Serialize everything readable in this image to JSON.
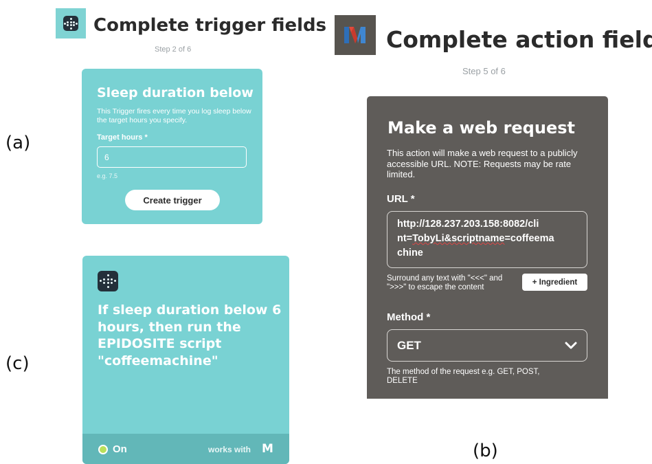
{
  "labels": {
    "a": "(a)",
    "b": "(b)",
    "c": "(c)"
  },
  "trigger": {
    "icon": "fitbit-icon",
    "heading": "Complete trigger fields",
    "step": "Step 2 of 6",
    "card_title": "Sleep duration below",
    "description": "This Trigger fires every time you log sleep below the target hours you specify.",
    "field_label": "Target hours *",
    "field_value": "6",
    "field_hint": "e.g. 7.5",
    "button_label": "Create trigger",
    "accent_color": "#79d2d3"
  },
  "applet": {
    "icon": "fitbit-icon",
    "text": "If sleep duration below 6 hours, then run the EPIDOSITE script \"coffeemachine\"",
    "status": "On",
    "works_with": "works with",
    "service_logo": "M"
  },
  "action": {
    "icon": "maker-icon",
    "heading": "Complete action fields",
    "step": "Step 5 of 6",
    "card_title": "Make a web request",
    "description": "This action will make a web request to a publicly accessible URL. NOTE: Requests may be rate limited.",
    "url_label": "URL *",
    "url_line1": "http://128.237.203.158:8082/cli",
    "url_line2_pre": "nt=",
    "url_line2_squiggle": "TobyLi&scriptname",
    "url_line2_post": "=coffeema",
    "url_line3": "chine",
    "ingredient_hint": "Surround any text with \"<<<\" and \">>>\" to escape the content",
    "ingredient_button": "+ Ingredient",
    "method_label": "Method *",
    "method_value": "GET",
    "method_hint": "The method of the request e.g. GET, POST, DELETE",
    "card_color": "#5f5c59"
  }
}
